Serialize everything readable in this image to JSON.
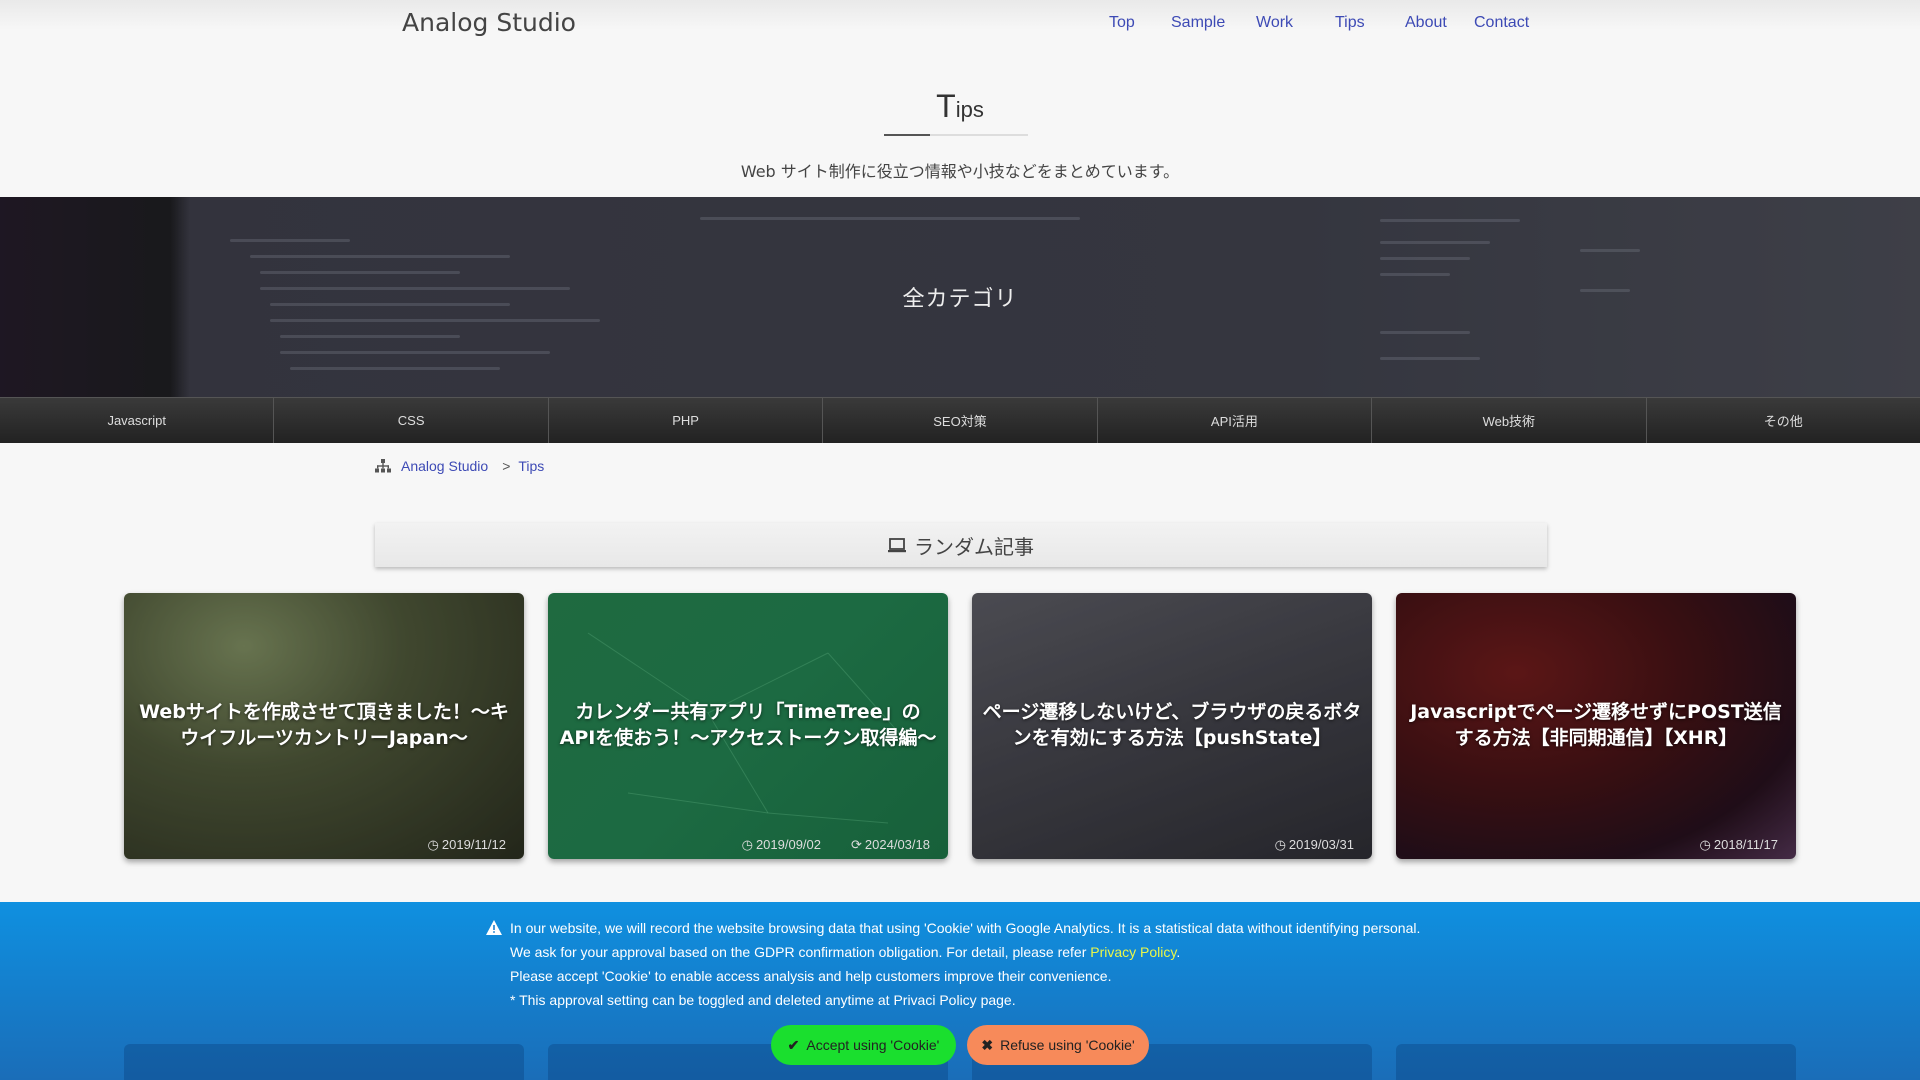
{
  "header": {
    "site_title": "Analog Studio",
    "nav": [
      "Top",
      "Sample",
      "Work",
      "Tips",
      "About",
      "Contact"
    ]
  },
  "page": {
    "heading_big": "T",
    "heading_small": "ips",
    "description": "Web サイト制作に役立つ情報や小技などをまとめています。"
  },
  "hero": {
    "title": "全カテゴリ"
  },
  "categories": [
    "Javascript",
    "CSS",
    "PHP",
    "SEO対策",
    "API活用",
    "Web技術",
    "その他"
  ],
  "breadcrumb": {
    "home": "Analog Studio",
    "separator": ">",
    "current": "Tips"
  },
  "section": {
    "title": "ランダム記事",
    "icon": "laptop-icon"
  },
  "cards": [
    {
      "title": "Webサイトを作成させて頂きました！〜キウイフルーツカントリーJapan〜",
      "posted": "2019/11/12",
      "updated": ""
    },
    {
      "title": "カレンダー共有アプリ「TimeTree」のAPIを使おう！〜アクセストークン取得編〜",
      "posted": "2019/09/02",
      "updated": "2024/03/18"
    },
    {
      "title": "ページ遷移しないけど、ブラウザの戻るボタンを有効にする方法【pushState】",
      "posted": "2019/03/31",
      "updated": ""
    },
    {
      "title": "Javascriptでページ遷移せずにPOST送信する方法【非同期通信】【XHR】",
      "posted": "2018/11/17",
      "updated": ""
    }
  ],
  "cookie": {
    "line1": "In our website, we will record the website browsing data that using 'Cookie' with Google Analytics. It is a statistical data without identifying personal.",
    "line2_prefix": "We ask for your approval based on the GDPR confirmation obligation. For detail, please refer ",
    "line2_link": "Privacy Policy",
    "line2_suffix": ".",
    "line3": "Please accept 'Cookie' to enable access analysis and help customers improve their convenience.",
    "line4": "* This approval setting can be toggled and deleted anytime at Privaci Policy page.",
    "accept_label": "Accept using 'Cookie'",
    "refuse_label": "Refuse using 'Cookie'"
  },
  "colors": {
    "link": "#3d4ab5",
    "cookie_bg": "#0f90e0",
    "accept": "#1adf2e",
    "refuse": "#f78a5a",
    "policy_link": "#e8f74a"
  }
}
